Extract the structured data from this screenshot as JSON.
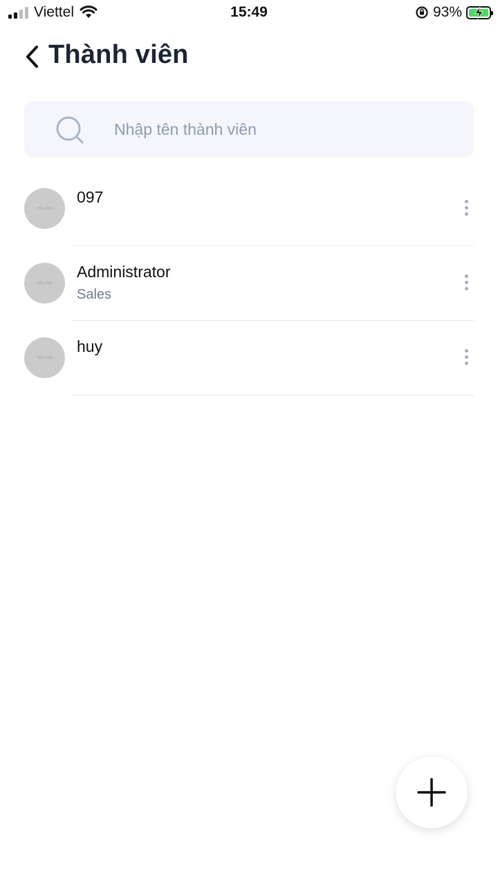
{
  "status_bar": {
    "carrier": "Viettel",
    "time": "15:49",
    "battery_percent": "93%",
    "battery_color": "#4cd964",
    "icons": [
      "signal-icon",
      "wifi-icon",
      "orientation-lock-icon",
      "battery-charging-icon"
    ]
  },
  "header": {
    "title": "Thành viên",
    "back_icon": "chevron-left-icon"
  },
  "search": {
    "placeholder": "Nhập tên thành viên",
    "value": "",
    "icon": "search-icon"
  },
  "members": [
    {
      "name": "097",
      "role": ""
    },
    {
      "name": "Administrator",
      "role": "Sales"
    },
    {
      "name": "huy",
      "role": ""
    }
  ],
  "avatar_placeholder_text": "150 x 150",
  "fab": {
    "icon": "plus-icon"
  },
  "colors": {
    "title": "#1c2536",
    "search_bg": "#f4f6fb",
    "placeholder": "#8f9bb0",
    "role_text": "#6c7b94",
    "more_dots": "#a3adbf"
  }
}
